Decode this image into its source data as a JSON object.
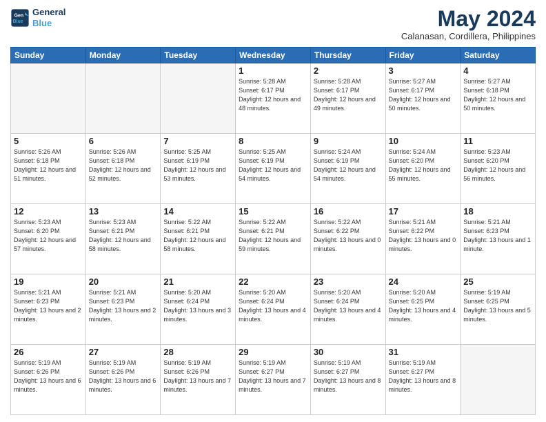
{
  "header": {
    "logo_line1": "General",
    "logo_line2": "Blue",
    "month": "May 2024",
    "location": "Calanasan, Cordillera, Philippines"
  },
  "days_of_week": [
    "Sunday",
    "Monday",
    "Tuesday",
    "Wednesday",
    "Thursday",
    "Friday",
    "Saturday"
  ],
  "weeks": [
    [
      {
        "day": "",
        "empty": true
      },
      {
        "day": "",
        "empty": true
      },
      {
        "day": "",
        "empty": true
      },
      {
        "day": "1",
        "sunrise": "5:28 AM",
        "sunset": "6:17 PM",
        "daylight": "12 hours and 48 minutes."
      },
      {
        "day": "2",
        "sunrise": "5:28 AM",
        "sunset": "6:17 PM",
        "daylight": "12 hours and 49 minutes."
      },
      {
        "day": "3",
        "sunrise": "5:27 AM",
        "sunset": "6:17 PM",
        "daylight": "12 hours and 50 minutes."
      },
      {
        "day": "4",
        "sunrise": "5:27 AM",
        "sunset": "6:18 PM",
        "daylight": "12 hours and 50 minutes."
      }
    ],
    [
      {
        "day": "5",
        "sunrise": "5:26 AM",
        "sunset": "6:18 PM",
        "daylight": "12 hours and 51 minutes."
      },
      {
        "day": "6",
        "sunrise": "5:26 AM",
        "sunset": "6:18 PM",
        "daylight": "12 hours and 52 minutes."
      },
      {
        "day": "7",
        "sunrise": "5:25 AM",
        "sunset": "6:19 PM",
        "daylight": "12 hours and 53 minutes."
      },
      {
        "day": "8",
        "sunrise": "5:25 AM",
        "sunset": "6:19 PM",
        "daylight": "12 hours and 54 minutes."
      },
      {
        "day": "9",
        "sunrise": "5:24 AM",
        "sunset": "6:19 PM",
        "daylight": "12 hours and 54 minutes."
      },
      {
        "day": "10",
        "sunrise": "5:24 AM",
        "sunset": "6:20 PM",
        "daylight": "12 hours and 55 minutes."
      },
      {
        "day": "11",
        "sunrise": "5:23 AM",
        "sunset": "6:20 PM",
        "daylight": "12 hours and 56 minutes."
      }
    ],
    [
      {
        "day": "12",
        "sunrise": "5:23 AM",
        "sunset": "6:20 PM",
        "daylight": "12 hours and 57 minutes."
      },
      {
        "day": "13",
        "sunrise": "5:23 AM",
        "sunset": "6:21 PM",
        "daylight": "12 hours and 58 minutes."
      },
      {
        "day": "14",
        "sunrise": "5:22 AM",
        "sunset": "6:21 PM",
        "daylight": "12 hours and 58 minutes."
      },
      {
        "day": "15",
        "sunrise": "5:22 AM",
        "sunset": "6:21 PM",
        "daylight": "12 hours and 59 minutes."
      },
      {
        "day": "16",
        "sunrise": "5:22 AM",
        "sunset": "6:22 PM",
        "daylight": "13 hours and 0 minutes."
      },
      {
        "day": "17",
        "sunrise": "5:21 AM",
        "sunset": "6:22 PM",
        "daylight": "13 hours and 0 minutes."
      },
      {
        "day": "18",
        "sunrise": "5:21 AM",
        "sunset": "6:23 PM",
        "daylight": "13 hours and 1 minute."
      }
    ],
    [
      {
        "day": "19",
        "sunrise": "5:21 AM",
        "sunset": "6:23 PM",
        "daylight": "13 hours and 2 minutes."
      },
      {
        "day": "20",
        "sunrise": "5:21 AM",
        "sunset": "6:23 PM",
        "daylight": "13 hours and 2 minutes."
      },
      {
        "day": "21",
        "sunrise": "5:20 AM",
        "sunset": "6:24 PM",
        "daylight": "13 hours and 3 minutes."
      },
      {
        "day": "22",
        "sunrise": "5:20 AM",
        "sunset": "6:24 PM",
        "daylight": "13 hours and 4 minutes."
      },
      {
        "day": "23",
        "sunrise": "5:20 AM",
        "sunset": "6:24 PM",
        "daylight": "13 hours and 4 minutes."
      },
      {
        "day": "24",
        "sunrise": "5:20 AM",
        "sunset": "6:25 PM",
        "daylight": "13 hours and 4 minutes."
      },
      {
        "day": "25",
        "sunrise": "5:19 AM",
        "sunset": "6:25 PM",
        "daylight": "13 hours and 5 minutes."
      }
    ],
    [
      {
        "day": "26",
        "sunrise": "5:19 AM",
        "sunset": "6:26 PM",
        "daylight": "13 hours and 6 minutes."
      },
      {
        "day": "27",
        "sunrise": "5:19 AM",
        "sunset": "6:26 PM",
        "daylight": "13 hours and 6 minutes."
      },
      {
        "day": "28",
        "sunrise": "5:19 AM",
        "sunset": "6:26 PM",
        "daylight": "13 hours and 7 minutes."
      },
      {
        "day": "29",
        "sunrise": "5:19 AM",
        "sunset": "6:27 PM",
        "daylight": "13 hours and 7 minutes."
      },
      {
        "day": "30",
        "sunrise": "5:19 AM",
        "sunset": "6:27 PM",
        "daylight": "13 hours and 8 minutes."
      },
      {
        "day": "31",
        "sunrise": "5:19 AM",
        "sunset": "6:27 PM",
        "daylight": "13 hours and 8 minutes."
      },
      {
        "day": "",
        "empty": true
      }
    ]
  ]
}
